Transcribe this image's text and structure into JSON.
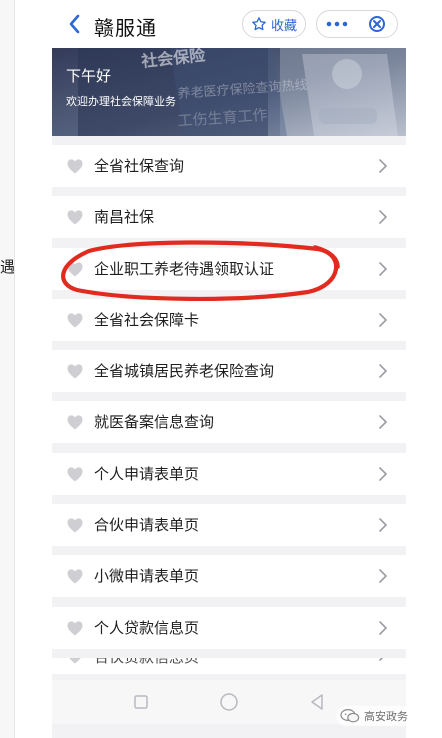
{
  "header": {
    "title": "赣服通",
    "collect_label": "收藏",
    "back_icon": "chevron-left-icon",
    "star_icon": "star-icon",
    "more_icon": "more-icon",
    "close_icon": "close-icon"
  },
  "banner": {
    "greeting": "下午好",
    "welcome": "欢迎办理社会保障业务",
    "background_text_1": "社会保险",
    "background_text_2": "养老医疗保险查询热线",
    "background_text_3": "工伤生育工作"
  },
  "menu": {
    "items": [
      {
        "label": "全省社保查询"
      },
      {
        "label": "南昌社保"
      },
      {
        "label": "企业职工养老待遇领取认证"
      },
      {
        "label": "全省社会保障卡"
      },
      {
        "label": "全省城镇居民养老保险查询"
      },
      {
        "label": "就医备案信息查询"
      },
      {
        "label": "个人申请表单页"
      },
      {
        "label": "合伙申请表单页"
      },
      {
        "label": "小微申请表单页"
      },
      {
        "label": "个人贷款信息页"
      },
      {
        "label": "合伙贷款信息页"
      }
    ]
  },
  "side": {
    "clipped_text": "遇"
  },
  "watermark": {
    "label": "高安政务"
  },
  "colors": {
    "accent": "#2d66d8",
    "annotation": "#e12b1f",
    "heart": "#cfcfd3",
    "chevron": "#9b9ba3"
  }
}
